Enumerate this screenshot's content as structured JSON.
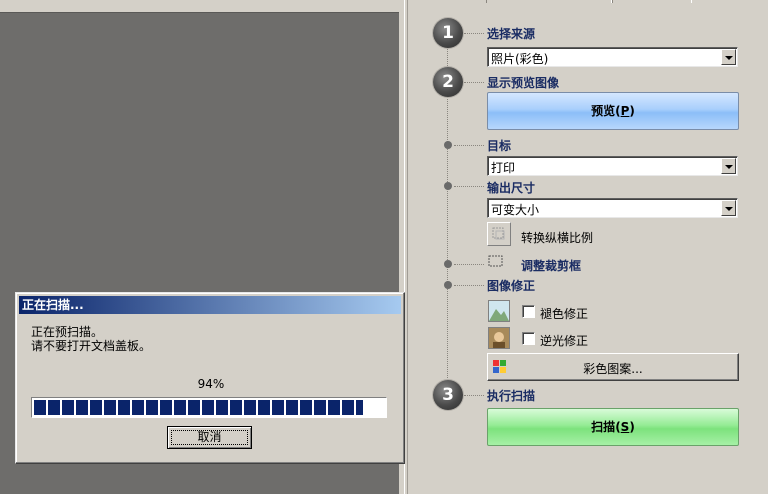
{
  "dialog": {
    "title": "正在扫描...",
    "message_line1": "正在预扫描。",
    "message_line2": "请不要打开文档盖板。",
    "progress_text": "94%",
    "progress_value": 0.94,
    "cancel_label": "取消"
  },
  "panel": {
    "step1": {
      "number": "1",
      "label": "选择来源",
      "source_value": "照片(彩色)"
    },
    "step2": {
      "number": "2",
      "label": "显示预览图像",
      "preview_button": "预览",
      "preview_hotkey": "P"
    },
    "destination": {
      "label": "目标",
      "value": "打印"
    },
    "output_size": {
      "label": "输出尺寸",
      "value": "可变大小",
      "swap_aspect_label": "转换纵横比例"
    },
    "crop": {
      "label": "调整裁剪框"
    },
    "image_correction": {
      "label": "图像修正",
      "fade_correction_label": "褪色修正",
      "fade_checked": false,
      "backlight_correction_label": "逆光修正",
      "backlight_checked": false,
      "color_pattern_button": "彩色图案..."
    },
    "step3": {
      "number": "3",
      "label": "执行扫描",
      "scan_button": "扫描",
      "scan_hotkey": "S"
    }
  },
  "colors": {
    "preview_button": "#a9cffc",
    "scan_button": "#95ec95",
    "section_label": "#1a2c63",
    "progress": "#0a246a",
    "titlebar": "#0a246a"
  }
}
